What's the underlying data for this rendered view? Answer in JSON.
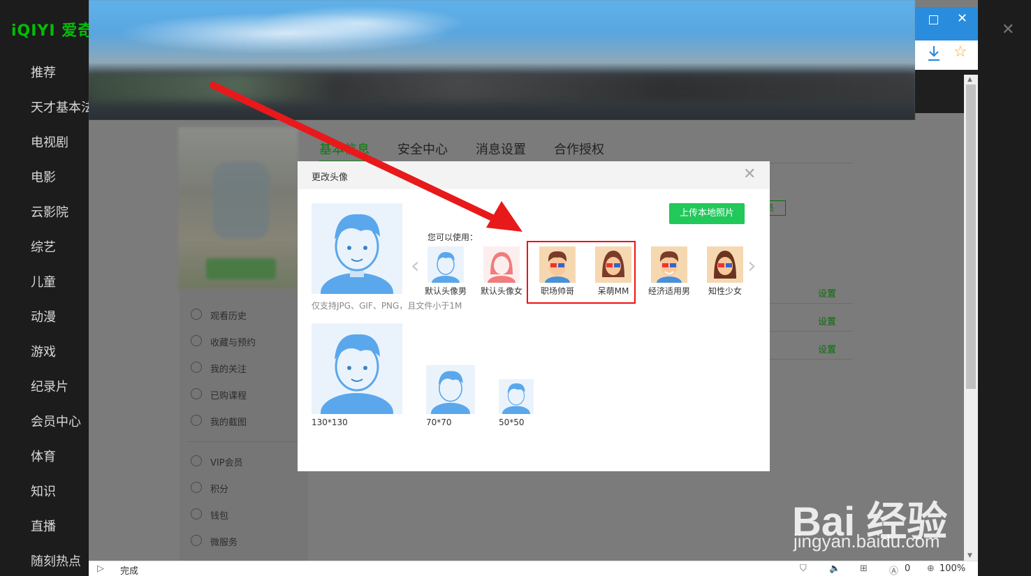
{
  "app": {
    "logo": "iQIYI 爱奇艺",
    "nav": [
      "推荐",
      "天才基本法",
      "电视剧",
      "电影",
      "云影院",
      "综艺",
      "儿童",
      "动漫",
      "游戏",
      "纪录片",
      "会员中心",
      "体育",
      "知识",
      "直播",
      "随刻热点"
    ]
  },
  "page": {
    "tabs": [
      "基本信息",
      "安全中心",
      "消息设置",
      "合作授权"
    ],
    "badge": "员",
    "menu": [
      "观看历史",
      "收藏与预约",
      "我的关注",
      "已购课程",
      "我的截图",
      "VIP会员",
      "积分",
      "钱包",
      "微服务"
    ],
    "settings_links": [
      "设置",
      "设置",
      "设置"
    ]
  },
  "modal": {
    "title": "更改头像",
    "upload_button": "上传本地照片",
    "can_use": "您可以使用：",
    "support_note": "仅支持JPG、GIF、PNG，且文件小于1M",
    "avatars": [
      {
        "label": "默认头像男",
        "icon": "default-male-avatar"
      },
      {
        "label": "默认头像女",
        "icon": "default-female-avatar"
      },
      {
        "label": "职场帅哥",
        "icon": "office-guy-avatar"
      },
      {
        "label": "呆萌MM",
        "icon": "cute-girl-avatar"
      },
      {
        "label": "经济适用男",
        "icon": "practical-guy-avatar"
      },
      {
        "label": "知性少女",
        "icon": "intellectual-girl-avatar"
      }
    ],
    "preview_sizes": [
      "130*130",
      "70*70",
      "50*50"
    ]
  },
  "status_bar": {
    "text": "完成",
    "ad_count": "0",
    "zoom": "100%"
  },
  "watermark": {
    "brand": "Bai 经验",
    "url": "jingyan.baidu.com"
  },
  "colors": {
    "brand_green": "#00be06",
    "upload_green": "#21c85a",
    "highlight_red": "#e11111",
    "window_blue": "#2a8cdc"
  }
}
